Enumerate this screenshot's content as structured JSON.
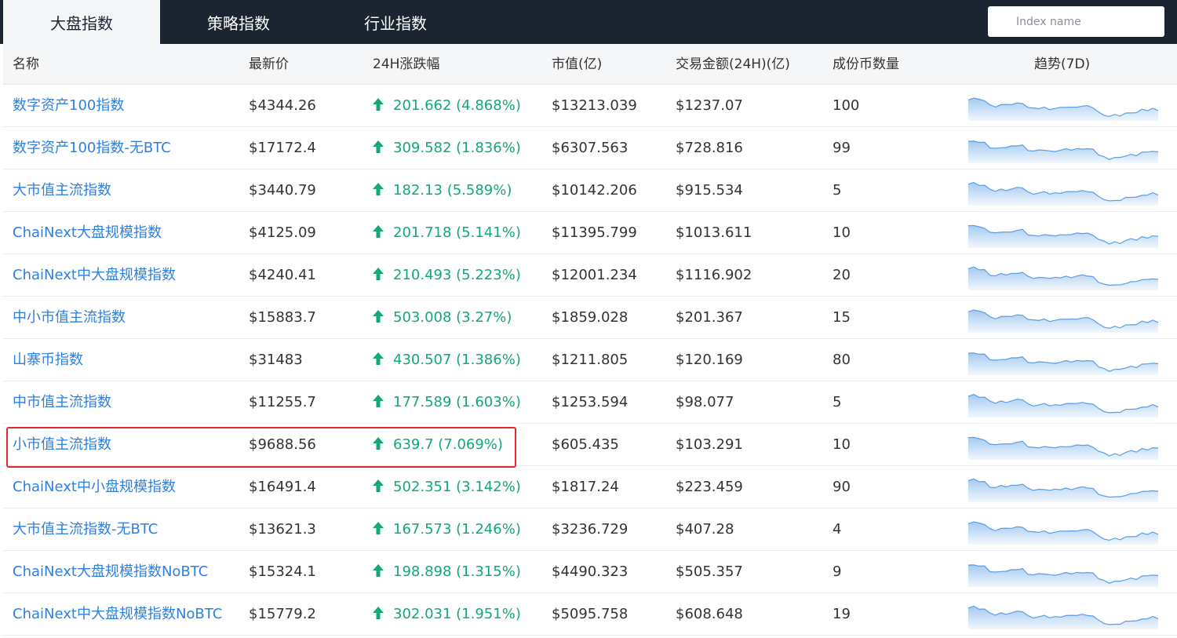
{
  "tabs": [
    {
      "label": "大盘指数",
      "active": true
    },
    {
      "label": "策略指数",
      "active": false
    },
    {
      "label": "行业指数",
      "active": false
    }
  ],
  "search": {
    "placeholder": "Index name",
    "value": ""
  },
  "columns": {
    "name": "名称",
    "price": "最新价",
    "change": "24H涨跌幅",
    "market_cap": "市值(亿)",
    "volume": "交易金额(24H)(亿)",
    "constituents": "成份币数量",
    "trend": "趋势(7D)"
  },
  "icons": {
    "change_up": "arrow-up-icon",
    "search": "search-icon"
  },
  "colors": {
    "link": "#2d7fe0",
    "up": "#13a77a",
    "sparkline": "#5a9ee6",
    "highlight": "#e0282e",
    "topbar": "#1b2531"
  },
  "sparkline": [
    0.85,
    0.9,
    0.82,
    0.8,
    0.6,
    0.55,
    0.62,
    0.6,
    0.64,
    0.68,
    0.7,
    0.5,
    0.45,
    0.47,
    0.5,
    0.44,
    0.46,
    0.48,
    0.52,
    0.5,
    0.54,
    0.56,
    0.55,
    0.5,
    0.3,
    0.2,
    0.12,
    0.18,
    0.15,
    0.25,
    0.3,
    0.28,
    0.4,
    0.38,
    0.45,
    0.4
  ],
  "rows": [
    {
      "name": "数字资产100指数",
      "price": "$4344.26",
      "change": "201.662 (4.868%)",
      "market_cap": "$13213.039",
      "volume": "$1237.07",
      "constituents": "100"
    },
    {
      "name": "数字资产100指数-无BTC",
      "price": "$17172.4",
      "change": "309.582 (1.836%)",
      "market_cap": "$6307.563",
      "volume": "$728.816",
      "constituents": "99"
    },
    {
      "name": "大市值主流指数",
      "price": "$3440.79",
      "change": "182.13 (5.589%)",
      "market_cap": "$10142.206",
      "volume": "$915.534",
      "constituents": "5"
    },
    {
      "name": "ChaiNext大盘规模指数",
      "price": "$4125.09",
      "change": "201.718 (5.141%)",
      "market_cap": "$11395.799",
      "volume": "$1013.611",
      "constituents": "10"
    },
    {
      "name": "ChaiNext中大盘规模指数",
      "price": "$4240.41",
      "change": "210.493 (5.223%)",
      "market_cap": "$12001.234",
      "volume": "$1116.902",
      "constituents": "20"
    },
    {
      "name": "中小市值主流指数",
      "price": "$15883.7",
      "change": "503.008 (3.27%)",
      "market_cap": "$1859.028",
      "volume": "$201.367",
      "constituents": "15"
    },
    {
      "name": "山寨币指数",
      "price": "$31483",
      "change": "430.507 (1.386%)",
      "market_cap": "$1211.805",
      "volume": "$120.169",
      "constituents": "80"
    },
    {
      "name": "中市值主流指数",
      "price": "$11255.7",
      "change": "177.589 (1.603%)",
      "market_cap": "$1253.594",
      "volume": "$98.077",
      "constituents": "5"
    },
    {
      "name": "小市值主流指数",
      "price": "$9688.56",
      "change": "639.7 (7.069%)",
      "market_cap": "$605.435",
      "volume": "$103.291",
      "constituents": "10",
      "highlighted": true
    },
    {
      "name": "ChaiNext中小盘规模指数",
      "price": "$16491.4",
      "change": "502.351 (3.142%)",
      "market_cap": "$1817.24",
      "volume": "$223.459",
      "constituents": "90"
    },
    {
      "name": "大市值主流指数-无BTC",
      "price": "$13621.3",
      "change": "167.573 (1.246%)",
      "market_cap": "$3236.729",
      "volume": "$407.28",
      "constituents": "4"
    },
    {
      "name": "ChaiNext大盘规模指数NoBTC",
      "price": "$15324.1",
      "change": "198.898 (1.315%)",
      "market_cap": "$4490.323",
      "volume": "$505.357",
      "constituents": "9"
    },
    {
      "name": "ChaiNext中大盘规模指数NoBTC",
      "price": "$15779.2",
      "change": "302.031 (1.951%)",
      "market_cap": "$5095.758",
      "volume": "$608.648",
      "constituents": "19"
    }
  ]
}
